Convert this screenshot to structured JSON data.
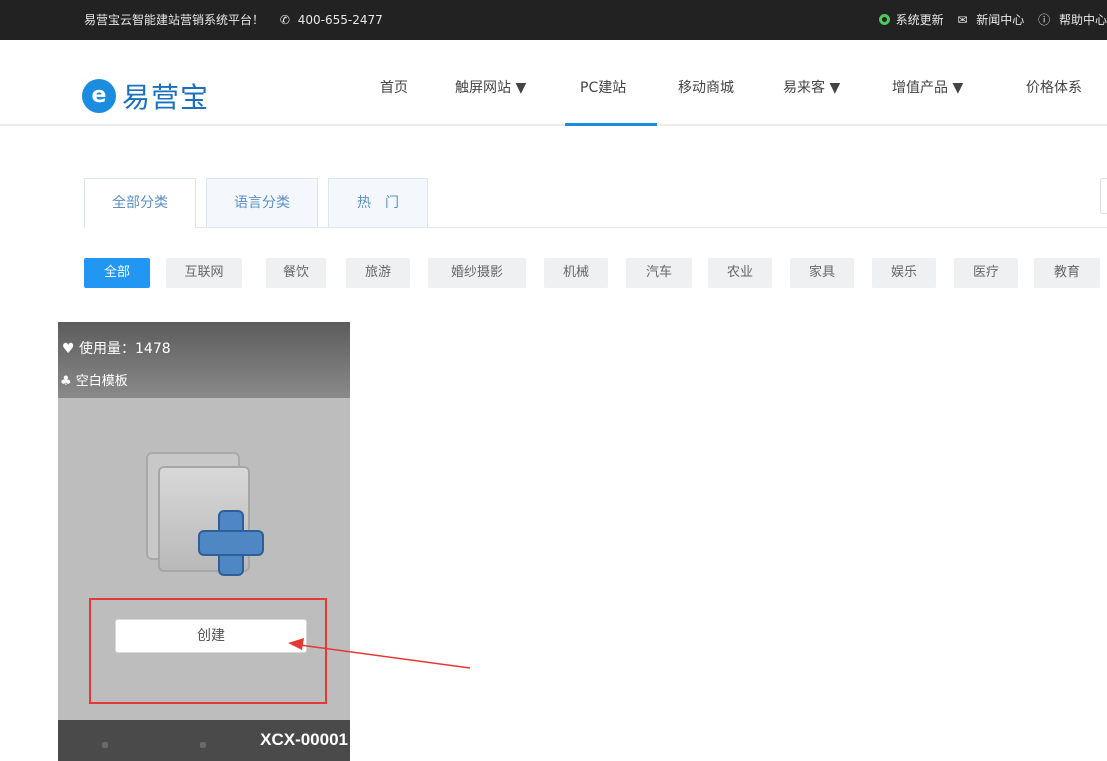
{
  "topbar": {
    "tagline": "易营宝云智能建站营销系统平台！",
    "phone": "400-655-2477",
    "links": [
      "系统更新",
      "新闻中心",
      "帮助中心"
    ]
  },
  "logo": {
    "mark": "e",
    "text": "易营宝"
  },
  "nav": {
    "items": [
      "首页",
      "触屏网站 ▼",
      "PC建站",
      "移动商城",
      "易来客 ▼",
      "增值产品 ▼",
      "价格体系"
    ],
    "active": "PC建站"
  },
  "tabs": [
    "全部分类",
    "语言分类",
    "热　门"
  ],
  "filters": [
    "全部",
    "互联网",
    "餐饮",
    "旅游",
    "婚纱摄影",
    "机械",
    "汽车",
    "农业",
    "家具",
    "娱乐",
    "医疗",
    "教育"
  ],
  "card": {
    "usage_label": "使用量：1478",
    "template_name": "空白模板",
    "create_button": "创建",
    "code": "XCX-00001"
  },
  "colors": {
    "accent": "#2196f3",
    "annotation": "#e53935",
    "topbar": "#222222"
  }
}
